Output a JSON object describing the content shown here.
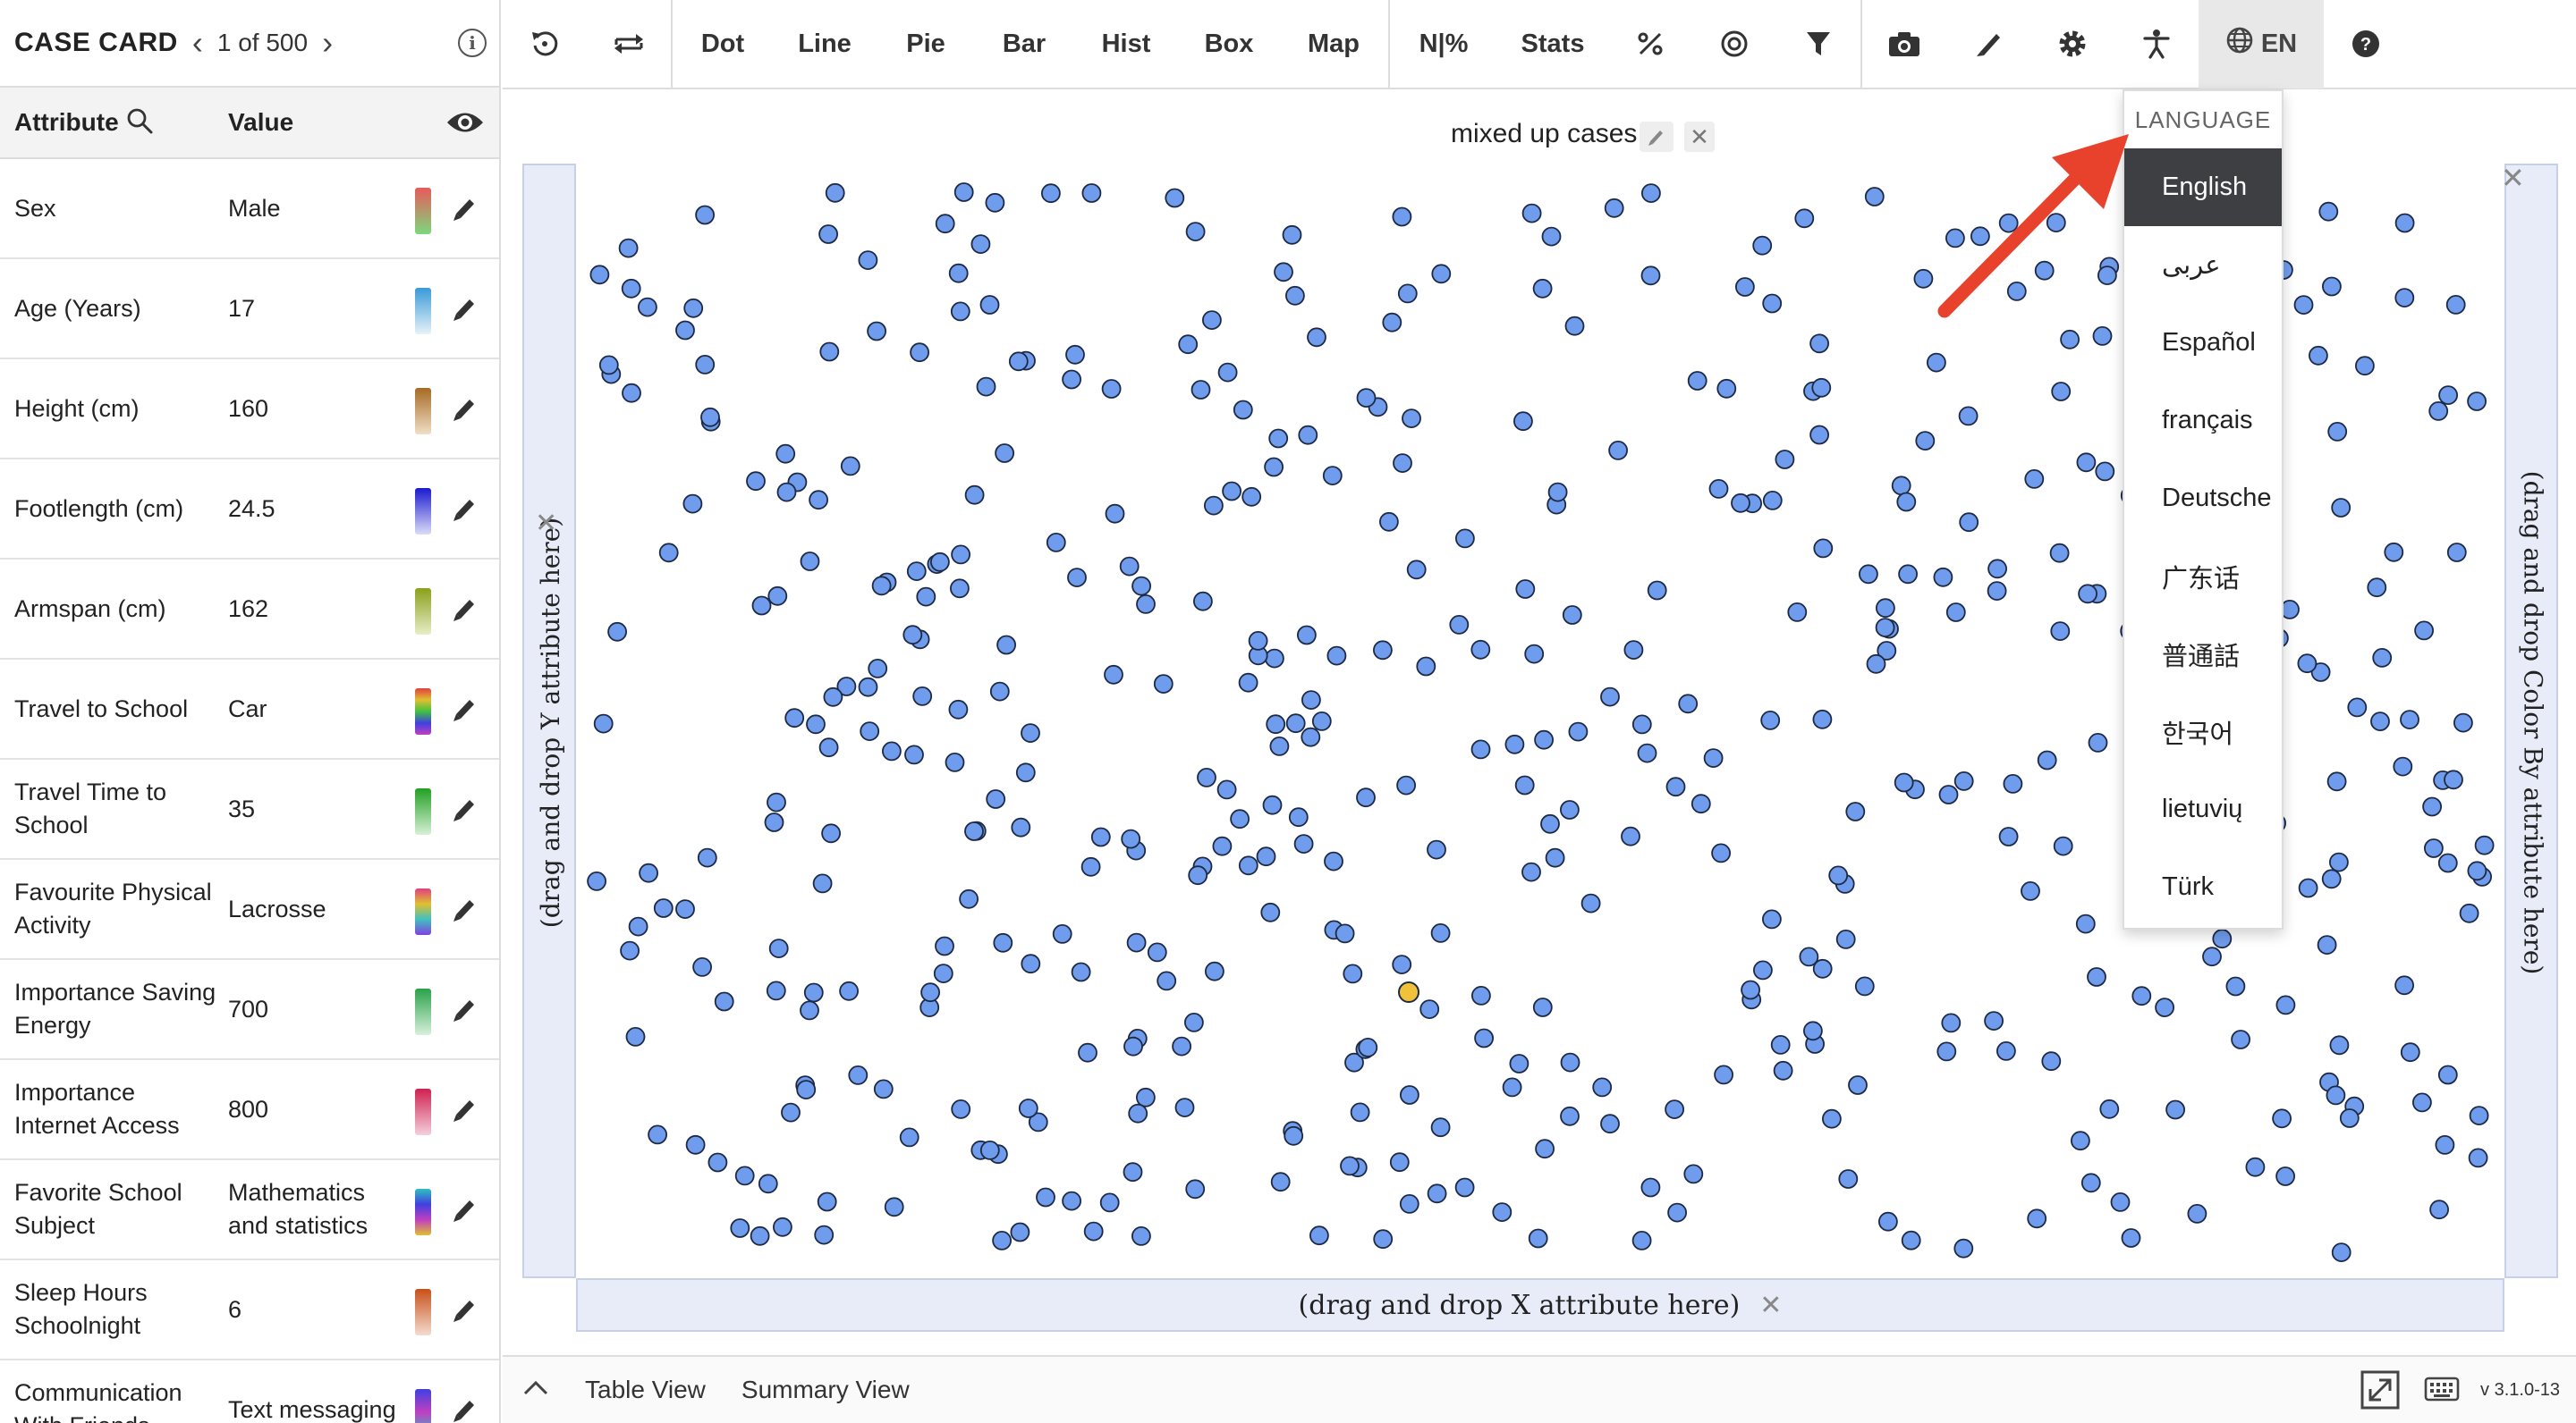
{
  "case_card": {
    "title": "CASE CARD",
    "counter": "1 of 500"
  },
  "attribute_table": {
    "attr_header": "Attribute",
    "value_header": "Value",
    "rows": [
      {
        "name": "Sex",
        "value": "Male",
        "color": [
          "#e85a5a",
          "#7dd87d"
        ]
      },
      {
        "name": "Age (Years)",
        "value": "17",
        "color": [
          "#3a9ad9",
          "#e8f2f8"
        ]
      },
      {
        "name": "Height (cm)",
        "value": "160",
        "color": [
          "#a66a24",
          "#f1dfc7"
        ]
      },
      {
        "name": "Footlength (cm)",
        "value": "24.5",
        "color": [
          "#1a1ad0",
          "#dcdcf8"
        ]
      },
      {
        "name": "Armspan (cm)",
        "value": "162",
        "color": [
          "#8aa01a",
          "#e8eec8"
        ]
      },
      {
        "name": "Travel to School",
        "value": "Car",
        "color": [
          "#e04040",
          "#e0c030",
          "#40c040",
          "#4040e0",
          "#c040c0"
        ]
      },
      {
        "name": "Travel Time to School",
        "value": "35",
        "color": [
          "#22a022",
          "#d8f0d8"
        ]
      },
      {
        "name": "Favourite Physical Activity",
        "value": "Lacrosse",
        "color": [
          "#e04080",
          "#e0c030",
          "#40c0c0",
          "#8040e0"
        ]
      },
      {
        "name": "Importance Saving Energy",
        "value": "700",
        "color": [
          "#2aa24a",
          "#d8f0dc"
        ]
      },
      {
        "name": "Importance Internet Access",
        "value": "800",
        "color": [
          "#d02050",
          "#f4d0dc"
        ]
      },
      {
        "name": "Favorite School Subject",
        "value": "Mathematics and statistics",
        "color": [
          "#30c0c0",
          "#4040e0",
          "#c040c0",
          "#e0c030"
        ]
      },
      {
        "name": "Sleep Hours Schoolnight",
        "value": "6",
        "color": [
          "#c8501a",
          "#f4dccf"
        ]
      },
      {
        "name": "Communication With Friends",
        "value": "Text messaging",
        "color": [
          "#4040e0",
          "#c040c0",
          "#30c0c0"
        ]
      }
    ]
  },
  "toolbar": {
    "buttons": [
      "Dot",
      "Line",
      "Pie",
      "Bar",
      "Hist",
      "Box",
      "Map",
      "N|%",
      "Stats"
    ],
    "language_button": "EN"
  },
  "plot": {
    "title": "mixed up cases",
    "y_drop_label": "(drag and drop Y attribute here)",
    "x_drop_label": "(drag and drop X attribute here)",
    "color_drop_label": "(drag and drop Color By attribute here)",
    "point_color": "#6f9cec",
    "highlight_color": "#f0c23c"
  },
  "language_menu": {
    "header": "LANGUAGE",
    "items": [
      "English",
      "عربى",
      "Español",
      "français",
      "Deutsche",
      "广东话",
      "普通話",
      "한국어",
      "lietuvių",
      "Türk"
    ],
    "selected": "English"
  },
  "bottom_bar": {
    "tabs": [
      "Table View",
      "Summary View"
    ],
    "version": "v 3.1.0-13"
  },
  "annotation": {
    "arrow_color": "#e8412c"
  }
}
